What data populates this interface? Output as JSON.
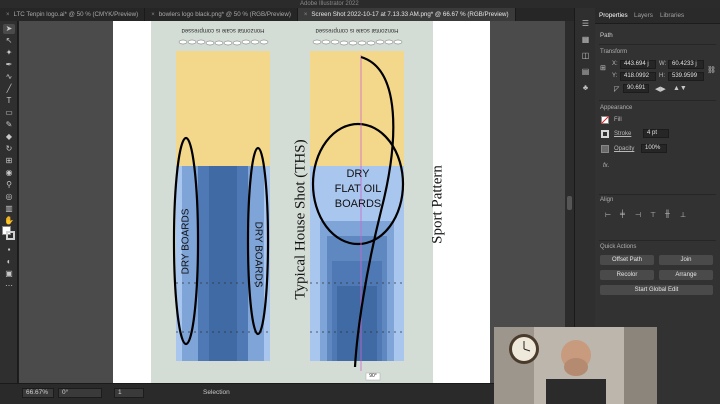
{
  "titlebar": {
    "text": "Adobe Illustrator 2022"
  },
  "tabs": [
    {
      "label": "LTC Tenpin logo.ai* @ 50 % (CMYK/Preview)",
      "active": false
    },
    {
      "label": "bowlers logo black.png* @ 50 % (RGB/Preview)",
      "active": false
    },
    {
      "label": "Screen Shot 2022-10-17 at 7.13.33 AM.png* @ 66.67 % (RGB/Preview)",
      "active": true
    }
  ],
  "tab_close": "×",
  "artwork": {
    "scale_label": "Horizontal scale is compressed",
    "left_title": "Typical House Shot (THS)",
    "right_title": "Sport Pattern",
    "dry_boards": "DRY BOARDS",
    "dry_flat_1": "DRY",
    "dry_flat_2": "FLAT OIL",
    "dry_flat_3": "BOARDS",
    "angle_readout": "90°",
    "colors": {
      "oil": "#3f6aa3",
      "dry": "#f3d78b",
      "background": "#d3ddd6"
    }
  },
  "statusbar": {
    "zoom": "66.67%",
    "rotation": "0°",
    "artboard": "1",
    "tool": "Selection"
  },
  "panel": {
    "tabs": [
      "Properties",
      "Layers",
      "Libraries"
    ],
    "section_path": "Path",
    "section_transform": "Transform",
    "x_label": "X:",
    "x_value": "443.694 j",
    "y_label": "Y:",
    "y_value": "418.0992",
    "w_label": "W:",
    "w_value": "60.4233 j",
    "h_label": "H:",
    "h_value": "539.9599",
    "angle_value": "90.691",
    "section_appearance": "Appearance",
    "fill_label": "Fill",
    "stroke_label": "Stroke",
    "stroke_value": "4 pt",
    "opacity_label": "Opacity",
    "opacity_value": "100%",
    "fx": "fx.",
    "section_align": "Align",
    "section_quick": "Quick Actions",
    "btn_offset": "Offset Path",
    "btn_join": "Join",
    "btn_recolor": "Recolor",
    "btn_arrange": "Arrange",
    "btn_global": "Start Global Edit"
  }
}
